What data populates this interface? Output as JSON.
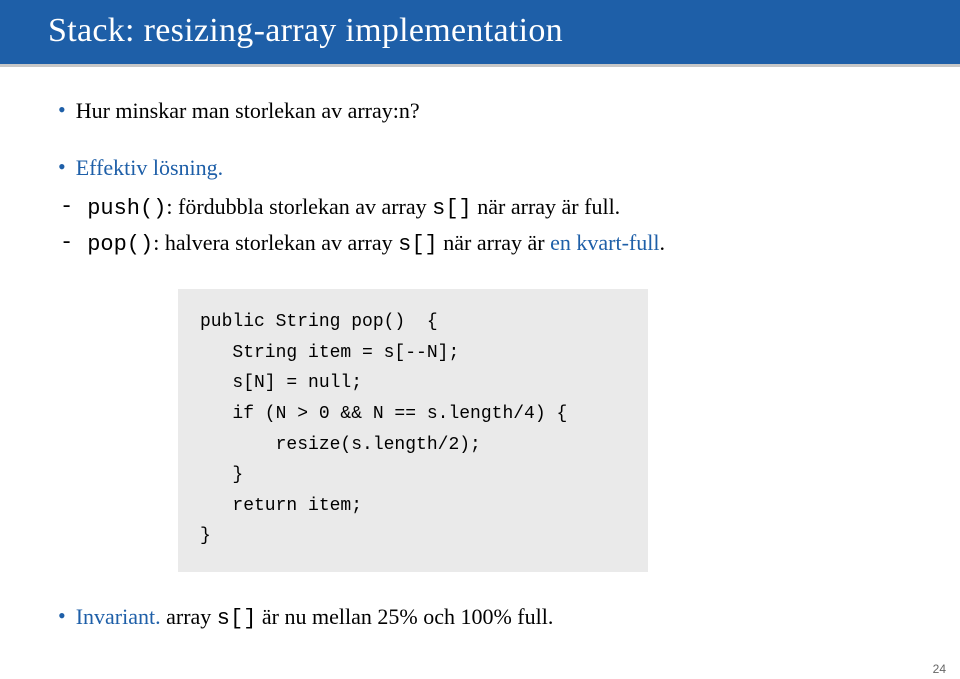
{
  "header": {
    "title": "Stack:  resizing-array implementation"
  },
  "bullets": {
    "q": "Hur minskar man storlekan av array:n?",
    "sol_prefix": "Effektiv lösning.",
    "dash1_code": "push()",
    "dash1_text": ": fördubbla storlekan av array ",
    "dash1_arr": "s[]",
    "dash1_tail": " när array är full.",
    "dash2_code": "pop()",
    "dash2_text": ":  halvera storlekan av array ",
    "dash2_arr": "s[]",
    "dash2_tail_a": " när array är ",
    "dash2_tail_highlight": "en kvart-full",
    "dash2_tail_b": ".",
    "inv_prefix": "Invariant.",
    "inv_text_a": " array ",
    "inv_arr": "s[]",
    "inv_text_b": " är nu mellan 25% och 100% full."
  },
  "code": "public String pop()  {\n   String item = s[--N];\n   s[N] = null;\n   if (N > 0 && N == s.length/4) {\n       resize(s.length/2);\n   }\n   return item;\n}",
  "page": "24"
}
